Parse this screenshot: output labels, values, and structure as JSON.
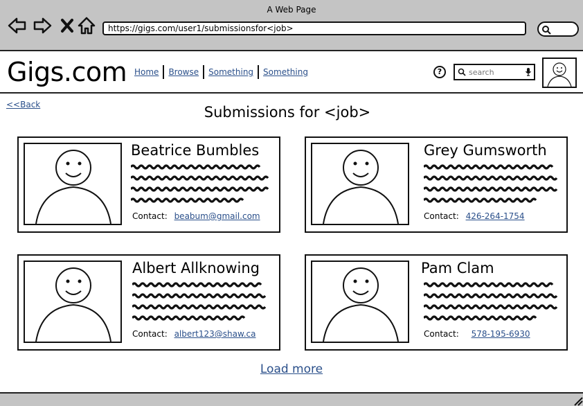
{
  "window": {
    "title": "A Web Page"
  },
  "browser": {
    "url": "https://gigs.com/user1/submissionsfor<job>"
  },
  "header": {
    "logo": "Gigs.com",
    "nav": [
      "Home",
      "Browse",
      "Something",
      "Something"
    ],
    "help_icon": "help-icon",
    "search": {
      "placeholder": "search"
    }
  },
  "page": {
    "back_label": "<<Back",
    "title": "Submissions for <job>",
    "contact_label": "Contact:",
    "load_more_label": "Load more"
  },
  "submissions": [
    {
      "name": "Beatrice Bumbles",
      "contact": "beabum@gmail.com"
    },
    {
      "name": "Grey Gumsworth",
      "contact": "426-264-1754"
    },
    {
      "name": "Albert Allknowing",
      "contact": "albert123@shaw.ca"
    },
    {
      "name": "Pam Clam",
      "contact": "578-195-6930"
    }
  ],
  "colors": {
    "chrome": "#c4c4c4",
    "link": "#2a4f8a"
  }
}
